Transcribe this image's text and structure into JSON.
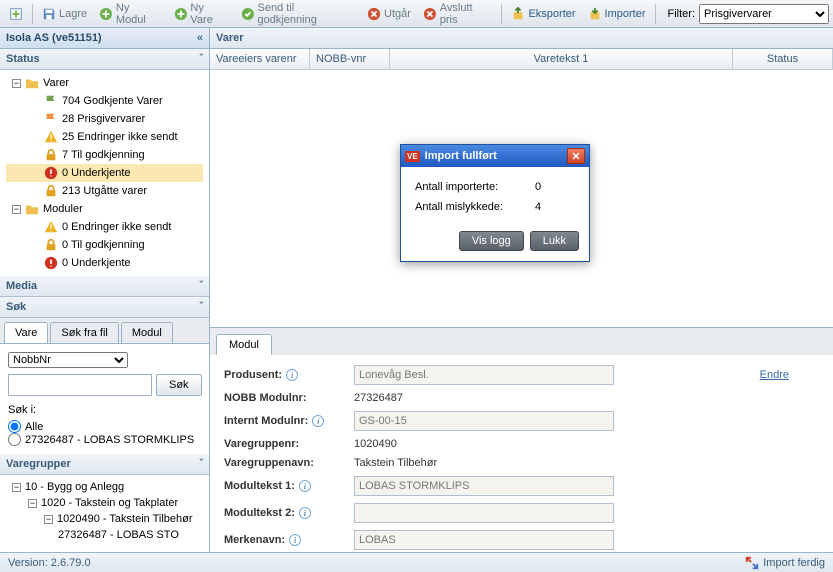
{
  "toolbar": {
    "lagre": "Lagre",
    "ny_modul": "Ny Modul",
    "ny_vare": "Ny Vare",
    "send_godkjenning": "Send til godkjenning",
    "utgar": "Utgår",
    "avslutt_pris": "Avslutt pris",
    "eksporter": "Eksporter",
    "importer": "Importer",
    "filter_label": "Filter:",
    "filter_value": "Prisgivervarer"
  },
  "left": {
    "title": "Isola AS (ve51151)",
    "status_header": "Status",
    "varer_label": "Varer",
    "moduler_label": "Moduler",
    "varer_items": [
      {
        "icon": "flag-green",
        "text": "704 Godkjente Varer"
      },
      {
        "icon": "flag-orange",
        "text": "28 Prisgivervarer"
      },
      {
        "icon": "warn",
        "text": "25 Endringer ikke sendt"
      },
      {
        "icon": "lock",
        "text": "7 Til godkjenning"
      },
      {
        "icon": "error",
        "text": "0 Underkjente"
      },
      {
        "icon": "lock",
        "text": "213 Utgåtte varer"
      }
    ],
    "moduler_items": [
      {
        "icon": "warn",
        "text": "0 Endringer ikke sendt"
      },
      {
        "icon": "lock",
        "text": "0 Til godkjenning"
      },
      {
        "icon": "error",
        "text": "0 Underkjente"
      }
    ],
    "media_header": "Media",
    "sok_header": "Søk",
    "tabs": {
      "vare": "Vare",
      "sok_fra_fil": "Søk fra fil",
      "modul": "Modul"
    },
    "sok_field": "NobbNr",
    "sok_btn": "Søk",
    "sok_i_label": "Søk i:",
    "radio_alle": "Alle",
    "radio_modul": "27326487 - LOBAS STORMKLIPS",
    "varegrupper_header": "Varegrupper",
    "vg_tree": [
      "10 - Bygg og Anlegg",
      "1020 - Takstein og Takplater",
      "1020490 - Takstein Tilbehør",
      "27326487 - LOBAS STO"
    ]
  },
  "grid": {
    "title": "Varer",
    "cols": {
      "c1": "Vareeiers varenr",
      "c2": "NOBB-vnr",
      "c3": "Varetekst 1",
      "c4": "Status"
    }
  },
  "detail": {
    "tab": "Modul",
    "rows": {
      "produsent": {
        "label": "Produsent:",
        "value": "Lonevåg Besl.",
        "endre": "Endre"
      },
      "nobb_modulnr": {
        "label": "NOBB Modulnr:",
        "value": "27326487"
      },
      "internt_modulnr": {
        "label": "Internt Modulnr:",
        "value": "GS-00-15"
      },
      "varegruppenr": {
        "label": "Varegruppenr:",
        "value": "1020490"
      },
      "varegruppenavn": {
        "label": "Varegruppenavn:",
        "value": "Takstein Tilbehør"
      },
      "modultekst1": {
        "label": "Modultekst 1:",
        "value": "LOBAS STORMKLIPS"
      },
      "modultekst2": {
        "label": "Modultekst 2:",
        "value": ""
      },
      "merkenavn": {
        "label": "Merkenavn:",
        "value": "LOBAS"
      }
    }
  },
  "dialog": {
    "title": "Import fullført",
    "r1_label": "Antall importerte:",
    "r1_val": "0",
    "r2_label": "Antall mislykkede:",
    "r2_val": "4",
    "btn_logg": "Vis logg",
    "btn_lukk": "Lukk"
  },
  "status": {
    "version": "Version: 2.6.79.0",
    "import_done": "Import ferdig"
  }
}
